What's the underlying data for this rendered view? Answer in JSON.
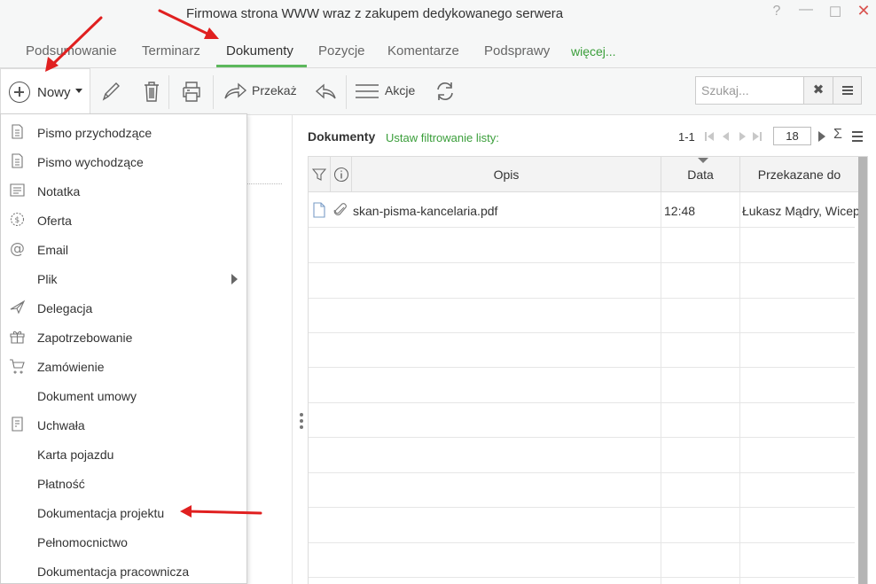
{
  "window": {
    "title": "Firmowa strona WWW wraz z zakupem dedykowanego serwera",
    "help_glyph": "?",
    "minimize_glyph": "—",
    "maximize_glyph": "☐",
    "close_glyph": "✕"
  },
  "tabs": [
    {
      "label": "Podsumowanie"
    },
    {
      "label": "Terminarz"
    },
    {
      "label": "Dokumenty",
      "active": true
    },
    {
      "label": "Pozycje"
    },
    {
      "label": "Komentarze"
    },
    {
      "label": "Podsprawy"
    },
    {
      "label": "więcej..."
    }
  ],
  "toolbar": {
    "new_label": "Nowy",
    "forward_label": "Przekaż",
    "actions_label": "Akcje",
    "search_placeholder": "Szukaj...",
    "search_clear_glyph": "✖"
  },
  "new_menu": {
    "items": [
      {
        "label": "Pismo przychodzące",
        "icon": "document-icon"
      },
      {
        "label": "Pismo wychodzące",
        "icon": "document-icon"
      },
      {
        "label": "Notatka",
        "icon": "note-icon"
      },
      {
        "label": "Oferta",
        "icon": "offer-icon"
      },
      {
        "label": "Email",
        "icon": "at-icon"
      },
      {
        "label": "Plik",
        "icon": "",
        "submenu": true
      },
      {
        "label": "Delegacja",
        "icon": "plane-icon"
      },
      {
        "label": "Zapotrzebowanie",
        "icon": "gift-icon"
      },
      {
        "label": "Zamówienie",
        "icon": "cart-icon"
      },
      {
        "label": "Dokument umowy",
        "icon": ""
      },
      {
        "label": "Uchwała",
        "icon": "resolution-icon"
      },
      {
        "label": "Karta pojazdu",
        "icon": ""
      },
      {
        "label": "Płatność",
        "icon": ""
      },
      {
        "label": "Dokumentacja projektu",
        "icon": ""
      },
      {
        "label": "Pełnomocnictwo",
        "icon": ""
      },
      {
        "label": "Dokumentacja pracownicza",
        "icon": ""
      }
    ]
  },
  "documents": {
    "title": "Dokumenty",
    "filter_link": "Ustaw filtrowanie listy:",
    "pager_range": "1-1",
    "page_size": "18",
    "sum_glyph": "Σ",
    "columns": {
      "description": "Opis",
      "date": "Data",
      "forwarded_to": "Przekazane do"
    },
    "rows": [
      {
        "description": "skan-pisma-kancelaria.pdf",
        "date": "12:48",
        "forwarded_to": "Łukasz Mądry, Wicep"
      }
    ]
  },
  "colors": {
    "accent_green": "#5cb85c",
    "link_green": "#3a9e3a",
    "annotation_red": "#e02020",
    "close_red": "#d9534f"
  }
}
